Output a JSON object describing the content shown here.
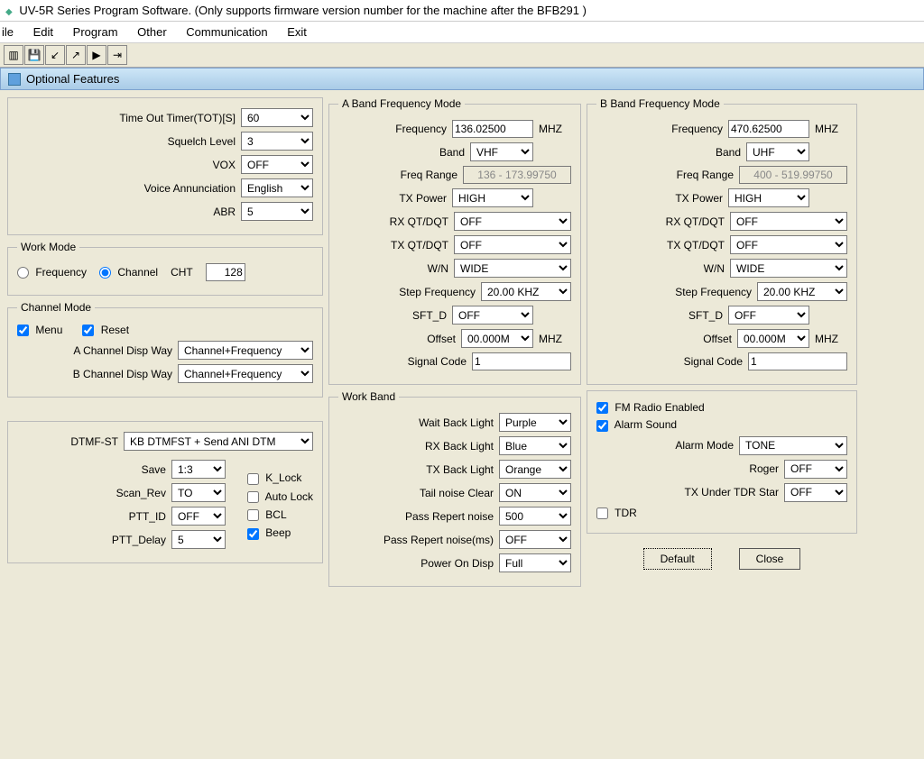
{
  "title": "UV-5R Series Program Software. (Only supports firmware version number for the machine after the BFB291 )",
  "menu": {
    "file": "ile",
    "edit": "Edit",
    "program": "Program",
    "other": "Other",
    "comm": "Communication",
    "exit": "Exit"
  },
  "panel_title": "Optional Features",
  "top": {
    "tot_label": "Time Out Timer(TOT)[S]",
    "tot_value": "60",
    "squelch_label": "Squelch Level",
    "squelch_value": "3",
    "vox_label": "VOX",
    "vox_value": "OFF",
    "voice_label": "Voice Annunciation",
    "voice_value": "English",
    "abr_label": "ABR",
    "abr_value": "5"
  },
  "workmode": {
    "legend": "Work Mode",
    "freq_label": "Frequency",
    "chan_label": "Channel",
    "cht_label": "CHT",
    "cht_value": "128",
    "selected": "channel"
  },
  "chanmode": {
    "legend": "Channel Mode",
    "menu_label": "Menu",
    "menu_checked": true,
    "reset_label": "Reset",
    "reset_checked": true,
    "a_disp_label": "A Channel Disp Way",
    "a_disp_value": "Channel+Frequency",
    "b_disp_label": "B Channel Disp Way",
    "b_disp_value": "Channel+Frequency"
  },
  "misc": {
    "dtmf_label": "DTMF-ST",
    "dtmf_value": "KB DTMFST + Send ANI DTM",
    "save_label": "Save",
    "save_value": "1:3",
    "scanrev_label": "Scan_Rev",
    "scanrev_value": "TO",
    "pttid_label": "PTT_ID",
    "pttid_value": "OFF",
    "pttdelay_label": "PTT_Delay",
    "pttdelay_value": "5",
    "klock_label": "K_Lock",
    "klock_checked": false,
    "autolock_label": "Auto Lock",
    "autolock_checked": false,
    "bcl_label": "BCL",
    "bcl_checked": false,
    "beep_label": "Beep",
    "beep_checked": true
  },
  "aband": {
    "legend": "A Band Frequency Mode",
    "freq_label": "Frequency",
    "freq_value": "136.02500",
    "freq_unit": "MHZ",
    "band_label": "Band",
    "band_value": "VHF",
    "range_label": "Freq Range",
    "range_value": "136 - 173.99750",
    "txpower_label": "TX Power",
    "txpower_value": "HIGH",
    "rxqt_label": "RX QT/DQT",
    "rxqt_value": "OFF",
    "txqt_label": "TX QT/DQT",
    "txqt_value": "OFF",
    "wn_label": "W/N",
    "wn_value": "WIDE",
    "step_label": "Step Frequency",
    "step_value": "20.00 KHZ",
    "sftd_label": "SFT_D",
    "sftd_value": "OFF",
    "offset_label": "Offset",
    "offset_value": "00.000M",
    "offset_unit": "MHZ",
    "sigcode_label": "Signal Code",
    "sigcode_value": "1"
  },
  "bband": {
    "legend": "B Band Frequency Mode",
    "freq_value": "470.62500",
    "freq_unit": "MHZ",
    "band_value": "UHF",
    "range_value": "400 - 519.99750",
    "txpower_value": "HIGH",
    "rxqt_value": "OFF",
    "txqt_value": "OFF",
    "wn_value": "WIDE",
    "step_value": "20.00 KHZ",
    "sftd_value": "OFF",
    "offset_value": "00.000M",
    "offset_unit": "MHZ",
    "sigcode_value": "1"
  },
  "workband": {
    "legend": "Work Band",
    "wait_bl_label": "Wait Back Light",
    "wait_bl_value": "Purple",
    "rx_bl_label": "RX Back Light",
    "rx_bl_value": "Blue",
    "tx_bl_label": "TX Back Light",
    "tx_bl_value": "Orange",
    "tail_label": "Tail noise Clear",
    "tail_value": "ON",
    "pass_rep_label": "Pass Repert noise",
    "pass_rep_value": "500",
    "pass_rep_ms_label": "Pass Repert noise(ms)",
    "pass_rep_ms_value": "OFF",
    "pon_label": "Power On Disp",
    "pon_value": "Full"
  },
  "extra": {
    "fm_label": "FM Radio Enabled",
    "fm_checked": true,
    "alarm_label": "Alarm Sound",
    "alarm_checked": true,
    "alarm_mode_label": "Alarm Mode",
    "alarm_mode_value": "TONE",
    "roger_label": "Roger",
    "roger_value": "OFF",
    "txtdr_label": "TX Under TDR Star",
    "txtdr_value": "OFF",
    "tdr_label": "TDR",
    "tdr_checked": false
  },
  "buttons": {
    "default": "Default",
    "close": "Close"
  }
}
